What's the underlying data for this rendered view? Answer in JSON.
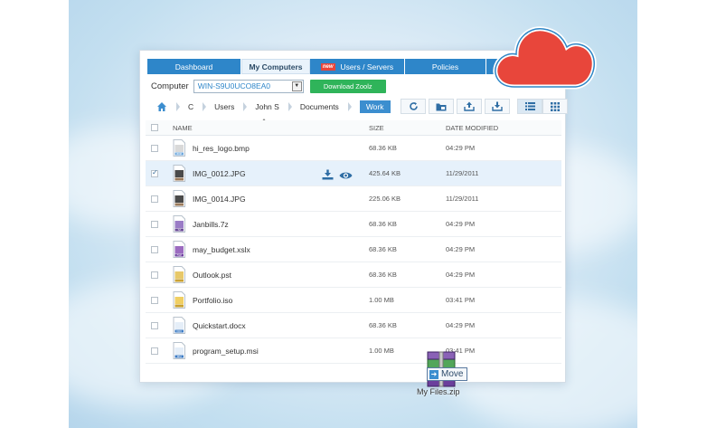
{
  "tabs": [
    {
      "label": "Dashboard",
      "active": false
    },
    {
      "label": "My Computers",
      "active": true
    },
    {
      "label": "Users / Servers",
      "badge": "new",
      "active": false
    },
    {
      "label": "Policies",
      "active": false
    },
    {
      "label": "",
      "active": false
    }
  ],
  "computer": {
    "label": "Computer",
    "selected": "WIN-S9U0UCO8EA0",
    "download_button": "Download Zoolz"
  },
  "breadcrumb": [
    "C",
    "Users",
    "John S",
    "Documents",
    "Work"
  ],
  "table": {
    "columns": {
      "name": "NAME",
      "size": "SIZE",
      "date": "DATE MODIFIED"
    },
    "rows": [
      {
        "name": "hi_res_logo.bmp",
        "size": "68.36 KB",
        "date": "04:29 PM",
        "type": "bmp",
        "checked": false
      },
      {
        "name": "IMG_0012.JPG",
        "size": "425.64 KB",
        "date": "11/29/2011",
        "type": "jpg",
        "checked": true
      },
      {
        "name": "IMG_0014.JPG",
        "size": "225.06 KB",
        "date": "11/29/2011",
        "type": "jpg",
        "checked": false
      },
      {
        "name": "Janbills.7z",
        "size": "68.36 KB",
        "date": "04:29 PM",
        "type": "7z",
        "checked": false
      },
      {
        "name": "may_budget.xslx",
        "size": "68.36 KB",
        "date": "04:29 PM",
        "type": "xlsx",
        "checked": false
      },
      {
        "name": "Outlook.pst",
        "size": "68.36 KB",
        "date": "04:29 PM",
        "type": "pst",
        "checked": false
      },
      {
        "name": "Portfolio.iso",
        "size": "1.00 MB",
        "date": "03:41 PM",
        "type": "iso",
        "checked": false
      },
      {
        "name": "Quickstart.docx",
        "size": "68.36 KB",
        "date": "04:29 PM",
        "type": "doc",
        "checked": false
      },
      {
        "name": "program_setup.msi",
        "size": "1.00 MB",
        "date": "03:41 PM",
        "type": "msi",
        "checked": false
      }
    ]
  },
  "drag": {
    "tooltip": "Move",
    "filename": "My Files.zip"
  },
  "colors": {
    "accent": "#2e86c9",
    "download": "#2fb45a",
    "cloud": "#e8463b",
    "new_badge": "#e8453a"
  }
}
